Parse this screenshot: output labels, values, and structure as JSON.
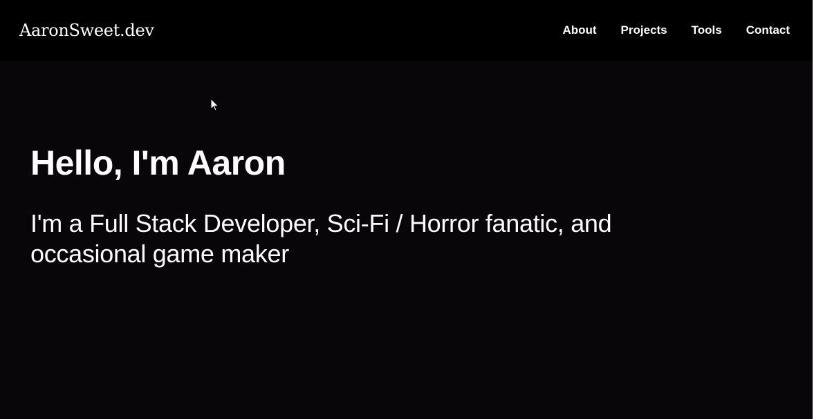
{
  "navbar": {
    "brand": "AaronSweet.dev",
    "links": [
      {
        "label": "About"
      },
      {
        "label": "Projects"
      },
      {
        "label": "Tools"
      },
      {
        "label": "Contact"
      }
    ]
  },
  "hero": {
    "title": "Hello, I'm Aaron",
    "subtitle": "I'm a Full Stack Developer, Sci-Fi / Horror fanatic, and occasional game maker"
  },
  "colors": {
    "page_background": "#080608",
    "navbar_background": "#000000",
    "text": "#ffffff"
  },
  "icons": {
    "cursor": "mouse-pointer-icon"
  }
}
